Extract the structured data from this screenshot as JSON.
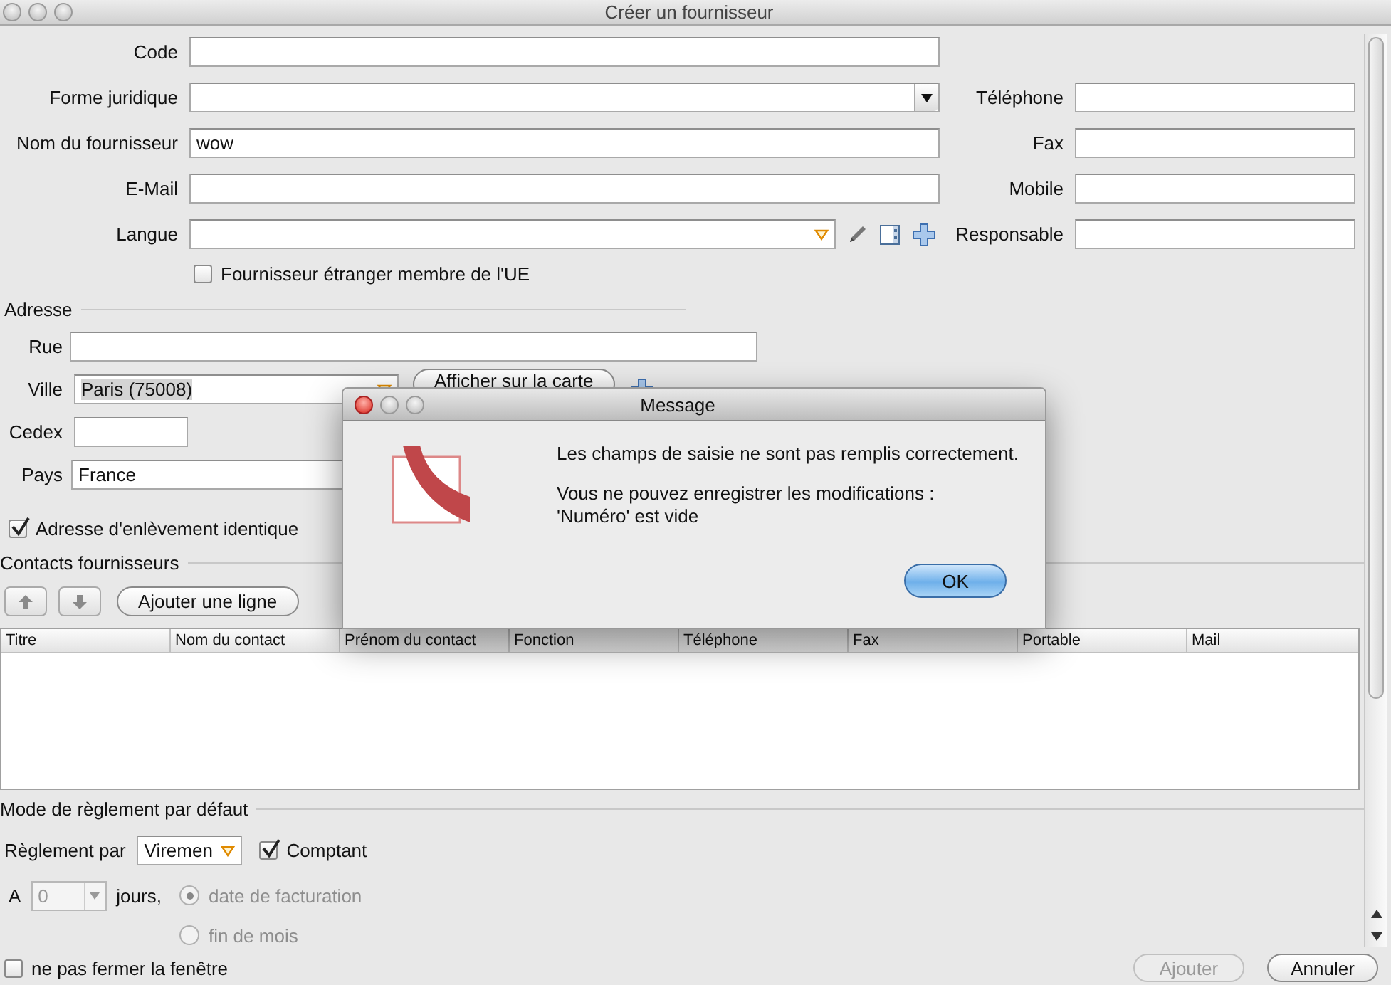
{
  "window": {
    "title": "Créer un fournisseur"
  },
  "supplier_form": {
    "rows": [
      {
        "label": "Code",
        "kind": "text"
      },
      {
        "label": "Forme juridique",
        "kind": "select"
      },
      {
        "label": "Nom du fournisseur",
        "kind": "text",
        "value": "wow"
      },
      {
        "label": "E-Mail",
        "kind": "text"
      },
      {
        "label": "Langue",
        "kind": "combo"
      }
    ],
    "contact_fields": [
      {
        "label": "Téléphone"
      },
      {
        "label": "Fax"
      },
      {
        "label": "Mobile"
      },
      {
        "label": "Responsable"
      }
    ],
    "eu_member": {
      "label": "Fournisseur étranger membre de l'UE",
      "checked": false
    }
  },
  "address": {
    "title": "Adresse",
    "rows": [
      {
        "label": "Rue",
        "kind": "text"
      },
      {
        "label": "Ville",
        "kind": "combo",
        "value": "Paris (75008)"
      },
      {
        "label": "Cedex",
        "kind": "short"
      },
      {
        "label": "Pays",
        "kind": "text",
        "value": "France"
      }
    ],
    "map_button": "Afficher sur la carte",
    "same_pickup": {
      "label": "Adresse d'enlèvement identique",
      "checked": true
    }
  },
  "contacts": {
    "title": "Contacts fournisseurs",
    "add_button": "Ajouter une ligne",
    "columns": [
      "Titre",
      "Nom du contact",
      "Prénom du contact",
      "Fonction",
      "Téléphone",
      "Fax",
      "Portable",
      "Mail"
    ]
  },
  "payment": {
    "title": "Mode de règlement par défaut",
    "method_label": "Règlement par",
    "method": "Viremen",
    "cash": {
      "label": "Comptant",
      "checked": true
    },
    "delay_prefix": "A",
    "delay": "0",
    "delay_suffix": "jours,",
    "disabled": true,
    "options": [
      {
        "label": "date de facturation",
        "selected": true
      },
      {
        "label": "fin de mois",
        "selected": false
      }
    ]
  },
  "footer": {
    "keep_open": {
      "label": "ne pas fermer la fenêtre",
      "checked": false
    },
    "buttons": [
      {
        "label": "Ajouter",
        "disabled": true
      },
      {
        "label": "Annuler",
        "disabled": false
      }
    ]
  },
  "dialog": {
    "title": "Message",
    "message": "Les champs de saisie ne sont pas remplis correctement.",
    "details": [
      "Vous ne pouvez enregistrer les modifications :",
      "'Numéro' est vide"
    ],
    "button": "OK"
  }
}
